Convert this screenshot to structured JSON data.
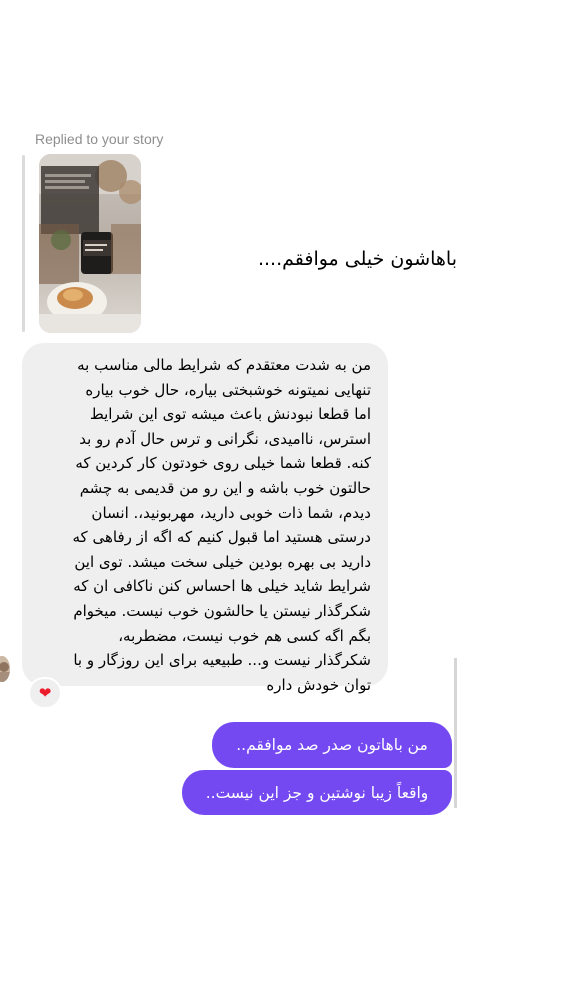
{
  "conversation": {
    "replied_label": "Replied to your story",
    "story_reply_text": "باهاشون خیلی موافقم....",
    "incoming_lines": [
      "من به شدت معتقدم که شرایط مالی مناسب به",
      "تنهایی نمیتونه خوشبختی بیاره، حال خوب بیاره",
      "اما قطعا نبودنش باعث میشه توی این شرایط",
      "استرس، ناامیدی، نگرانی و ترس حال آدم رو بد",
      "کنه. قطعا شما خیلی روی خودتون کار کردین که",
      "حالتون خوب باشه و این رو من قدیمی به چشم",
      "دیدم، شما ذات خوبی دارید، مهربونید،. انسان",
      "درستی هستید اما قبول کنیم که اگه از رفاهی که",
      "دارید بی بهره بودین خیلی سخت میشد. توی این",
      "شرایط شاید خیلی ها احساس کنن ناکافی ان که",
      "شکرگذار نیستن یا حالشون خوب نیست. میخوام",
      "بگم اگه کسی هم خوب نیست، مضطربه،",
      "شکرگذار نیست و... طبیعیه برای این روزگار و با",
      "توان خودش داره"
    ],
    "reaction_emoji": "❤",
    "outgoing": [
      "من باهاتون صدر صد موافقم..",
      "واقعاً زیبا نوشتین و جز این نیست.."
    ]
  },
  "colors": {
    "outgoing_bubble": "#7449f2",
    "incoming_bubble": "#efefef",
    "reaction": "#ed1c2c",
    "meta_text": "#8e8e8e"
  },
  "icons": {
    "reaction": "heart-icon"
  }
}
